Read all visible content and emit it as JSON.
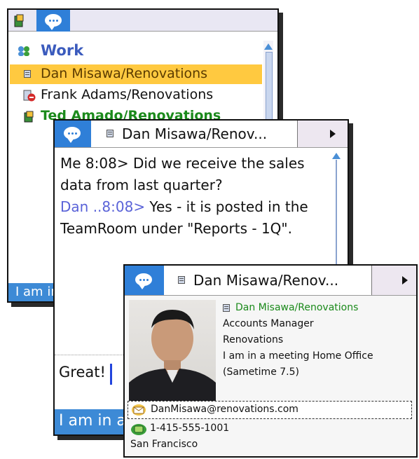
{
  "contacts_window": {
    "group_name": "Work",
    "contacts": [
      {
        "name": "Dan Misawa/Renovations",
        "selected": true
      },
      {
        "name": "Frank Adams/Renovations",
        "selected": false
      },
      {
        "name": "Ted Amado/Renovations",
        "selected": false
      }
    ],
    "status_text": "I am in"
  },
  "chat_window": {
    "tab_title": "Dan Misawa/Renov...",
    "messages": [
      {
        "sender": "Me 8:08>",
        "text": " Did we receive the sales data from last quarter?"
      },
      {
        "sender": "Dan ..8:08>",
        "text": " Yes - it is posted in the TeamRoom under \"Reports - 1Q\"."
      }
    ],
    "input_value": "Great!",
    "status_text": "I am in a"
  },
  "business_card": {
    "tab_title": "Dan Misawa/Renov...",
    "name": "Dan Misawa/Renovations",
    "title": "Accounts Manager",
    "company": "Renovations",
    "status_line": "I am in a meeting Home Office",
    "client": "(Sametime 7.5)",
    "email": "DanMisawa@renovations.com",
    "phone": "1-415-555-1001",
    "location": "San Francisco"
  },
  "colors": {
    "accent_blue": "#2f7fd8",
    "selection_yellow": "#ffc940",
    "online_green": "#1b8a1b",
    "dan_link_blue": "#5a63d8"
  },
  "icons": [
    "people-group-icon",
    "chat-bubble-icon",
    "document-status-icon",
    "do-not-disturb-icon",
    "away-icon",
    "email-icon",
    "phone-icon",
    "arrow-right-icon",
    "scroll-up-icon"
  ]
}
